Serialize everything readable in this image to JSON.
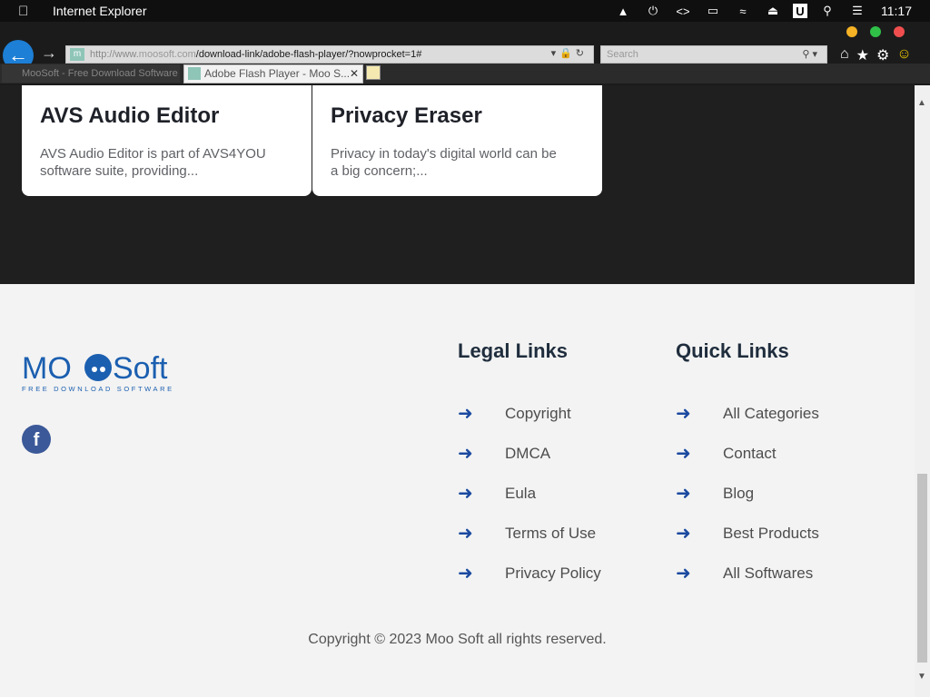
{
  "menubar": {
    "app_name": "Internet Explorer",
    "time": "11:17"
  },
  "browser": {
    "address_prefix": "http://www.",
    "address_domain": "moosoft.com",
    "address_path": "/download-link/adobe-flash-player/?nowprocket=1#",
    "search_placeholder": "Search",
    "tab_active_title": "Adobe Flash Player - Moo S...",
    "tab_inactive_title": "MooSoft - Free Download Software"
  },
  "cards": [
    {
      "title": "AVS Audio Editor",
      "description_l1": "AVS Audio Editor is part of AVS4YOU",
      "description_l2": "software suite, providing..."
    },
    {
      "title": "Privacy Eraser",
      "description_l1": "Privacy in today's digital world can be",
      "description_l2": "a big concern;..."
    }
  ],
  "footer": {
    "legal_title": "Legal Links",
    "quick_title": "Quick Links",
    "legal_links": [
      "Copyright",
      "DMCA",
      "Eula",
      "Terms of Use",
      "Privacy Policy"
    ],
    "quick_links": [
      "All Categories",
      "Contact",
      "Blog",
      "Best Products",
      "All Softwares"
    ],
    "copyright": "Copyright © 2023 Moo Soft all rights reserved.",
    "logo_text": "MOOSoft",
    "logo_tagline": "FREE DOWNLOAD SOFTWARE"
  }
}
